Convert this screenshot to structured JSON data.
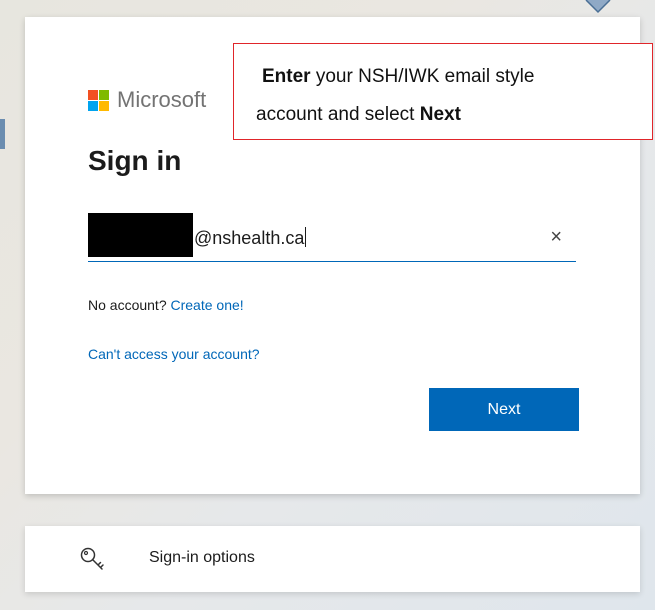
{
  "logo": {
    "text": "Microsoft",
    "colors": [
      "#f25022",
      "#7fba00",
      "#00a4ef",
      "#ffb900"
    ]
  },
  "title": "Sign in",
  "email_field": {
    "value": "@nshealth.ca",
    "clear_glyph": "×"
  },
  "no_account": {
    "prefix": "No account?",
    "link": "Create one!"
  },
  "cant_access_link": "Can't access your account?",
  "next_button": "Next",
  "sign_in_options": {
    "label": "Sign-in options",
    "icon": "key-icon"
  },
  "callout": {
    "line1_bold": "Enter",
    "line1_rest": "your NSH/IWK email style",
    "line2_rest": "account and select",
    "line2_bold": "Next"
  },
  "colors": {
    "accent": "#0067b8",
    "callout_border": "#e0252a"
  }
}
